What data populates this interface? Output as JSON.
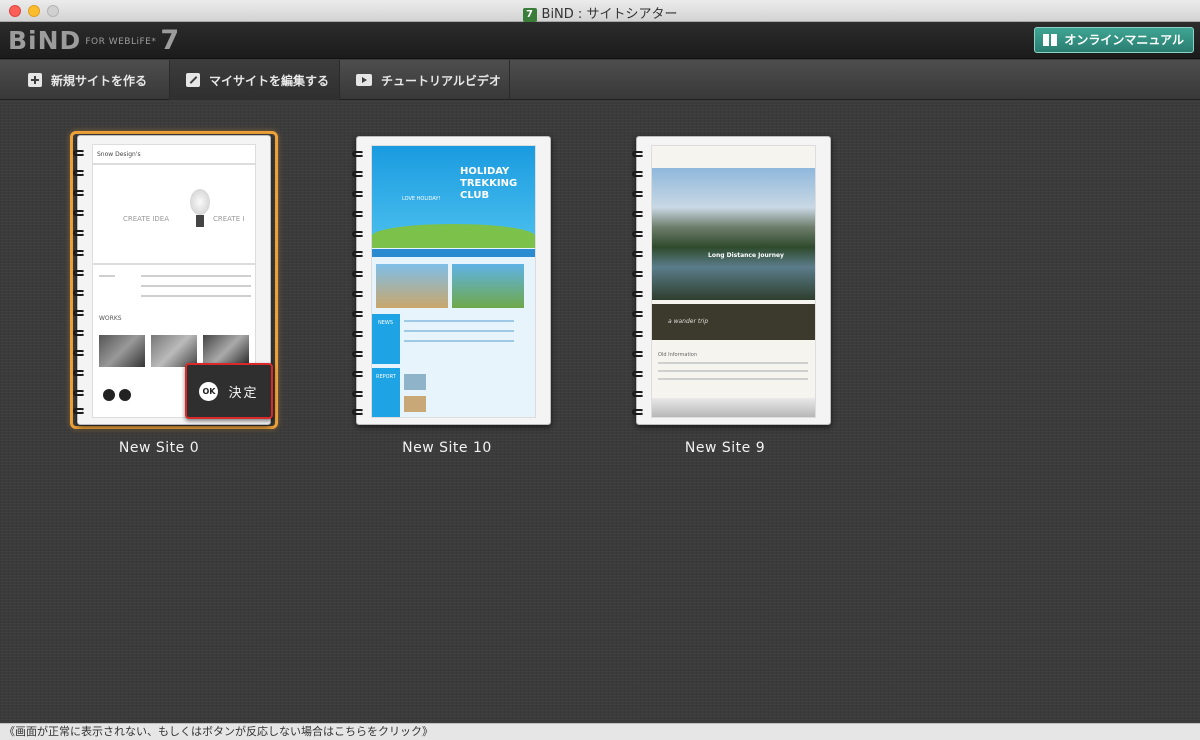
{
  "window": {
    "title": "BiND : サイトシアター",
    "app_badge": "7"
  },
  "header": {
    "logo_main": "BiND",
    "logo_sub": "FOR WEBLiFE*",
    "logo_version": "7",
    "manual_button": "オンラインマニュアル"
  },
  "toolbar": {
    "new_site": "新規サイトを作る",
    "edit_site": "マイサイトを編集する",
    "tutorial": "チュートリアルビデオ"
  },
  "sites": [
    {
      "name": "New Site 0",
      "selected": true
    },
    {
      "name": "New Site 10",
      "selected": false
    },
    {
      "name": "New Site 9",
      "selected": false
    }
  ],
  "thumbnails": {
    "site0": {
      "brand": "Snow Design's",
      "headline_left": "CREATE IDEA",
      "headline_right": "CREATE I",
      "section": "WORKS"
    },
    "site10": {
      "headline": "HOLIDAY\nTREKKING\nCLUB",
      "tag": "LOVE HOLIDAY!",
      "news": "NEWS",
      "report": "REPORT"
    },
    "site9": {
      "headline": "Long Distance Journey",
      "brand": "a wander trip",
      "section": "Old Information"
    }
  },
  "confirm_button": {
    "ok": "OK",
    "label": "決定"
  },
  "statusbar": {
    "message": "《画面が正常に表示されない、もしくはボタンが反応しない場合はこちらをクリック》"
  },
  "colors": {
    "selection": "#f0a338",
    "ok_border": "#d82a2a",
    "manual_button": "#2a7d70"
  }
}
